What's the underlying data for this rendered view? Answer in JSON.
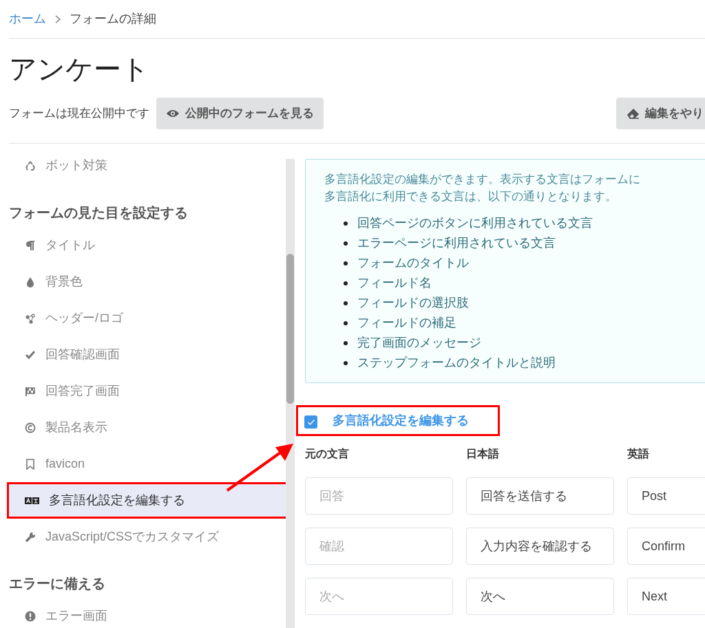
{
  "breadcrumb": [
    {
      "label": "ホーム",
      "kind": "link"
    },
    {
      "label": "フォームの詳細",
      "kind": "current"
    }
  ],
  "title": "アンケート",
  "status_text": "フォームは現在公開中です",
  "view_button": "公開中のフォームを見る",
  "edit_button": "編集をやり",
  "sidebar": [
    {
      "items": [
        {
          "label": "ボット対策",
          "selected": false
        }
      ]
    },
    {
      "heading": "フォームの見た目を設定する",
      "items": [
        {
          "label": "タイトル",
          "selected": false
        },
        {
          "label": "背景色",
          "selected": false
        },
        {
          "label": "ヘッダー/ロゴ",
          "selected": false
        },
        {
          "label": "回答確認画面",
          "selected": false
        },
        {
          "label": "回答完了画面",
          "selected": false
        },
        {
          "label": "製品名表示",
          "selected": false
        },
        {
          "label": "favicon",
          "selected": false
        },
        {
          "label": "多言語化設定を編集する",
          "selected": true
        },
        {
          "label": "JavaScript/CSSでカスタマイズ",
          "selected": false
        }
      ]
    },
    {
      "heading": "エラーに備える",
      "items": [
        {
          "label": "エラー画面",
          "selected": false
        }
      ]
    }
  ],
  "info": {
    "lines": [
      "多言語化設定の編集ができます。表示する文言はフォームに",
      "多言語化に利用できる文言は、以下の通りとなります。"
    ],
    "items": [
      "回答ページのボタンに利用されている文言",
      "エラーページに利用されている文言",
      "フォームのタイトル",
      "フィールド名",
      "フィールドの選択肢",
      "フィールドの補足",
      "完了画面のメッセージ",
      "ステップフォームのタイトルと説明"
    ]
  },
  "edit_checkbox": {
    "label": "多言語化設定を編集する",
    "checked": true
  },
  "table": {
    "columns": [
      "元の文言",
      "日本語",
      "英語"
    ],
    "rows": [
      {
        "placeholder": "回答",
        "japanese": "回答を送信する",
        "english": "Post"
      },
      {
        "placeholder": "確認",
        "japanese": "入力内容を確認する",
        "english": "Confirm"
      },
      {
        "placeholder": "次へ",
        "japanese": "次へ",
        "english": "Next"
      }
    ]
  }
}
